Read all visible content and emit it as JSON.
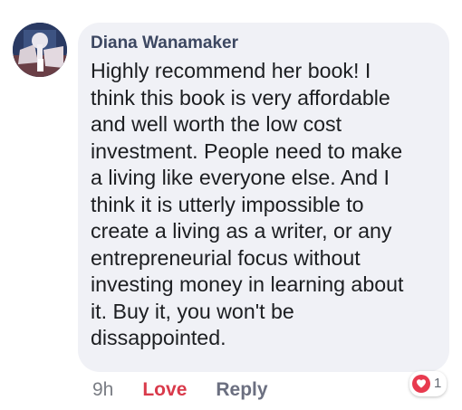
{
  "comment": {
    "author": "Diana Wanamaker",
    "text": "Highly recommend her book!  I\nthink this book is very affordable\nand well worth the low cost\ninvestment.  People need to make\na living like everyone else. And I\nthink it is utterly impossible to\ncreate a living as a writer, or any\nentrepreneurial focus without\ninvesting money in learning about\nit.  Buy it, you won't be\ndissappointed.",
    "avatar_icon": "profile-photo"
  },
  "actions": {
    "time": "9h",
    "love_label": "Love",
    "reply_label": "Reply"
  },
  "reactions": {
    "icon": "heart-icon",
    "count": "1",
    "color": "#e83a4f"
  },
  "colors": {
    "bubble": "#f0f1f6",
    "author": "#3c4761",
    "love": "#d93a4b",
    "reply": "#6b6f80",
    "time": "#7a7d84"
  }
}
